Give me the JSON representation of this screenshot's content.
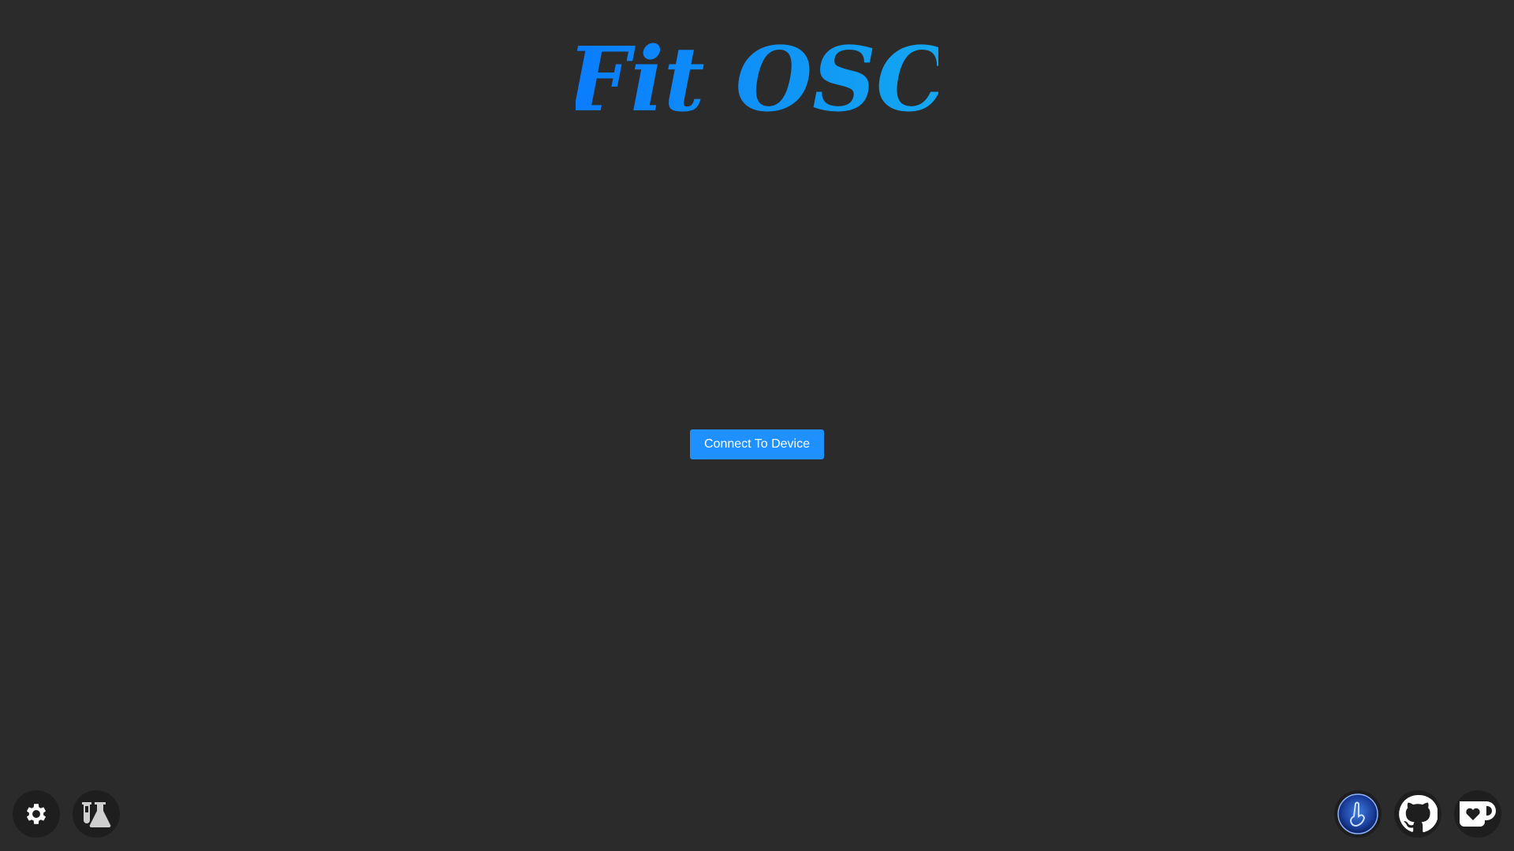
{
  "app": {
    "title": "Fit OSC",
    "accent_color": "#1e90ff",
    "title_gradient": [
      "#0a7cff",
      "#14a8f0"
    ]
  },
  "main": {
    "connect_label": "Connect To Device"
  },
  "toolbar_left": [
    {
      "name": "settings",
      "icon": "gear-icon"
    },
    {
      "name": "experimental",
      "icon": "flask-icon"
    }
  ],
  "toolbar_right": [
    {
      "name": "app-logo-link",
      "icon": "hand-logo-icon"
    },
    {
      "name": "github-link",
      "icon": "github-icon"
    },
    {
      "name": "kofi-link",
      "icon": "kofi-cup-icon"
    }
  ]
}
